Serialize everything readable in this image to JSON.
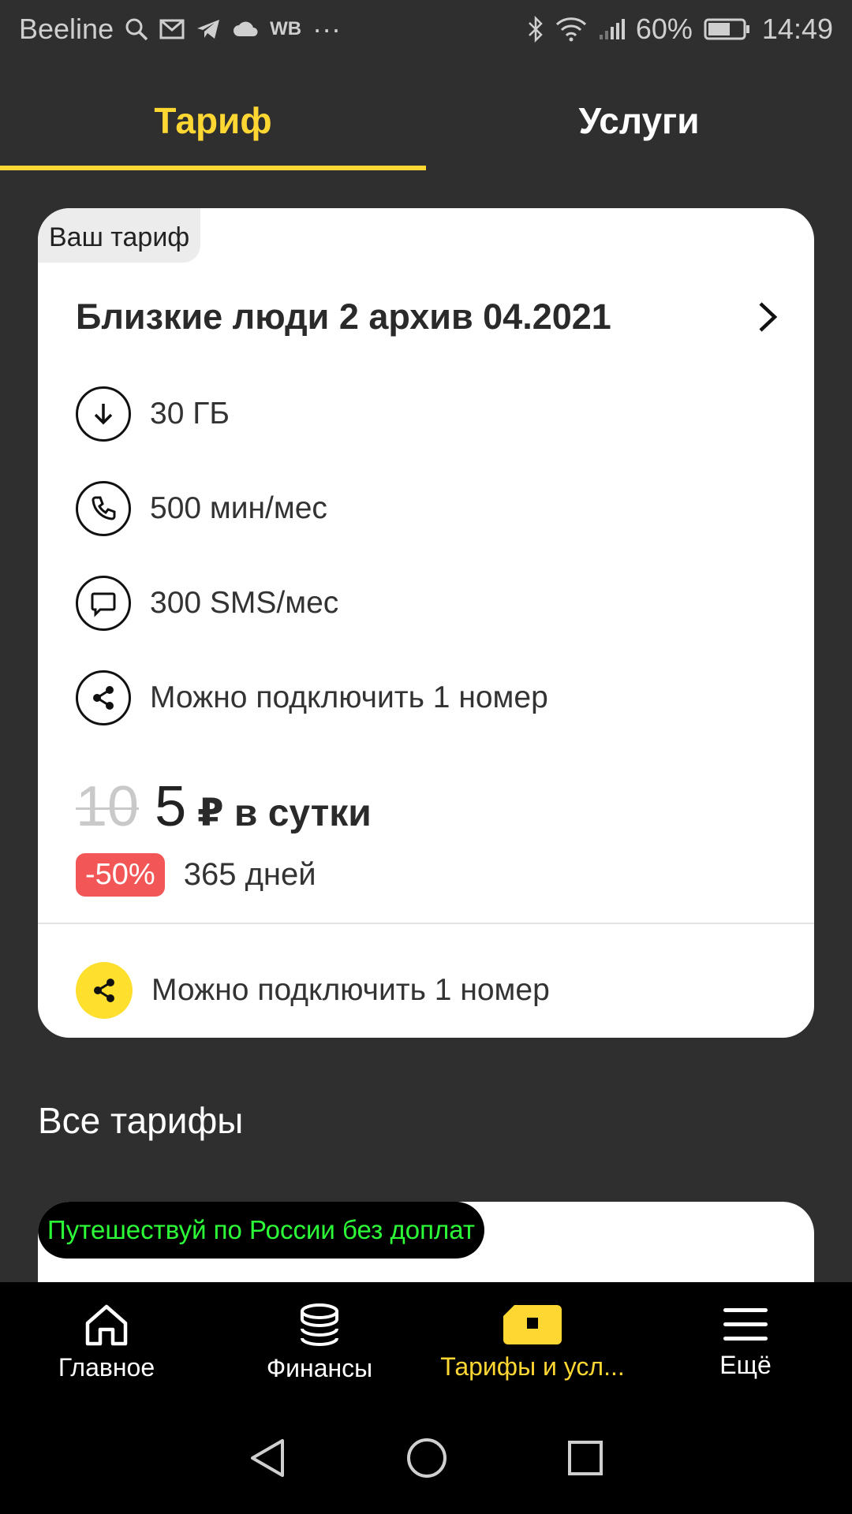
{
  "status_bar": {
    "carrier": "Beeline",
    "wb_label": "WB",
    "more": "···",
    "battery": "60%",
    "time": "14:49"
  },
  "tabs": [
    {
      "label": "Тариф",
      "active": true
    },
    {
      "label": "Услуги",
      "active": false
    }
  ],
  "tariff_card": {
    "badge": "Ваш тариф",
    "name": "Близкие люди 2 архив 04.2021",
    "features": [
      {
        "icon": "download-icon",
        "text": "30 ГБ"
      },
      {
        "icon": "phone-icon",
        "text": "500 мин/мес"
      },
      {
        "icon": "sms-icon",
        "text": "300 SMS/мес"
      },
      {
        "icon": "share-icon",
        "text": "Можно подключить 1 номер"
      }
    ],
    "old_price": "10",
    "new_price": "5",
    "price_unit": "₽ в сутки",
    "discount": "-50%",
    "duration": "365 дней",
    "connect_text": "Можно подключить 1 номер"
  },
  "all_tariffs": {
    "title": "Все тарифы",
    "promo_tag": "Путешествуй по России без доплат"
  },
  "bottom_nav": [
    {
      "icon": "home-icon",
      "label": "Главное",
      "active": false
    },
    {
      "icon": "coins-icon",
      "label": "Финансы",
      "active": false
    },
    {
      "icon": "sim-card-icon",
      "label": "Тарифы и усл...",
      "active": true
    },
    {
      "icon": "menu-icon",
      "label": "Ещё",
      "active": false
    }
  ],
  "colors": {
    "accent": "#ffd733",
    "background": "#2f2f2f",
    "discount": "#f25656",
    "promo_text": "#2cff38"
  }
}
